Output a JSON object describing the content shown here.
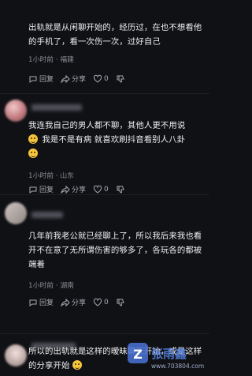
{
  "comments": [
    {
      "text": "出轨就是从闲聊开始的，经历过，在也不想看他的手机了，看一次伤一次，过好自己",
      "meta": "1小时前 · 福建",
      "reply_label": "回复",
      "share_label": "分享",
      "likes": "0"
    },
    {
      "text1": "我连我自己的男人都不聊，其他人更不用说",
      "text2": "我是不是有病 就喜欢刷抖音看别人八卦",
      "meta": "1小时前 · 山东",
      "reply_label": "回复",
      "share_label": "分享",
      "likes": "0"
    },
    {
      "text": "几年前我老公就已经聊上了，所以我后来我也看开不在意了无所谓伤害的够多了，各玩各的都被端着",
      "meta": "1小时前 · 湖南",
      "reply_label": "回复",
      "share_label": "分享",
      "likes": "0"
    },
    {
      "text": "所以的出轨就是这样的暧昧聊天开始，或是这样的分享开始"
    }
  ],
  "watermark": {
    "brand": "张雨鑫",
    "url": "www.703804.com"
  }
}
